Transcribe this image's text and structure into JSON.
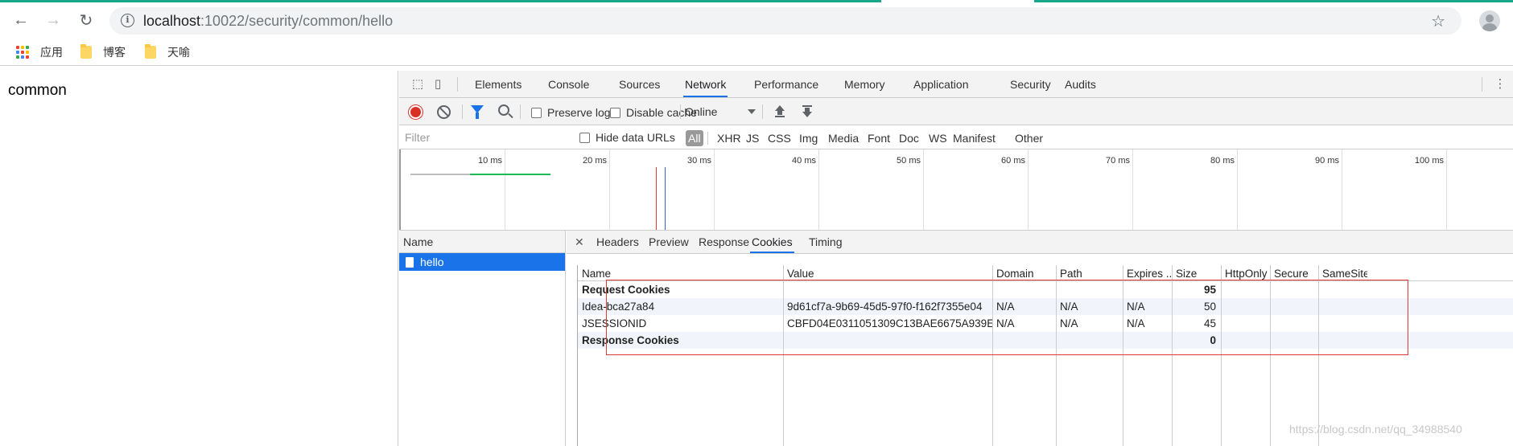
{
  "browser": {
    "url_host": "localhost",
    "url_rest": ":10022/security/common/hello",
    "bookmarks": [
      {
        "label": "应用",
        "icon": "apps-grid-icon"
      },
      {
        "label": "博客",
        "icon": "folder-icon"
      },
      {
        "label": "天喻",
        "icon": "folder-icon"
      }
    ]
  },
  "page": {
    "body_text": "common"
  },
  "devtools": {
    "tabs": [
      "Elements",
      "Console",
      "Sources",
      "Network",
      "Performance",
      "Memory",
      "Application",
      "Security",
      "Audits"
    ],
    "active_tab": "Network",
    "toolbar": {
      "preserve_log": "Preserve log",
      "disable_cache": "Disable cache",
      "throttling": "Online"
    },
    "filter": {
      "placeholder": "Filter",
      "hide_data_urls": "Hide data URLs",
      "types": [
        "All",
        "XHR",
        "JS",
        "CSS",
        "Img",
        "Media",
        "Font",
        "Doc",
        "WS",
        "Manifest",
        "Other"
      ]
    },
    "timeline": {
      "ticks": [
        "10 ms",
        "20 ms",
        "30 ms",
        "40 ms",
        "50 ms",
        "60 ms",
        "70 ms",
        "80 ms",
        "90 ms",
        "100 ms"
      ]
    },
    "requests": {
      "header": "Name",
      "items": [
        "hello"
      ]
    },
    "detail": {
      "tabs": [
        "Headers",
        "Preview",
        "Response",
        "Cookies",
        "Timing"
      ],
      "active_tab": "Cookies",
      "columns": [
        "Name",
        "Value",
        "Domain",
        "Path",
        "Expires ...",
        "Size",
        "HttpOnly",
        "Secure",
        "SameSite"
      ],
      "rows": [
        {
          "name": "Request Cookies",
          "value": "",
          "domain": "",
          "path": "",
          "expires": "",
          "size": "95",
          "group": true
        },
        {
          "name": "Idea-bca27a84",
          "value": "9d61cf7a-9b69-45d5-97f0-f162f7355e04",
          "domain": "N/A",
          "path": "N/A",
          "expires": "N/A",
          "size": "50",
          "group": false
        },
        {
          "name": "JSESSIONID",
          "value": "CBFD04E0311051309C13BAE6675A939E",
          "domain": "N/A",
          "path": "N/A",
          "expires": "N/A",
          "size": "45",
          "group": false
        },
        {
          "name": "Response Cookies",
          "value": "",
          "domain": "",
          "path": "",
          "expires": "",
          "size": "0",
          "group": true
        }
      ]
    }
  },
  "watermark": "https://blog.csdn.net/qq_34988540",
  "colors": {
    "accent": "#1a73e8",
    "record": "#d93025",
    "highlight": "#e03a3a"
  }
}
